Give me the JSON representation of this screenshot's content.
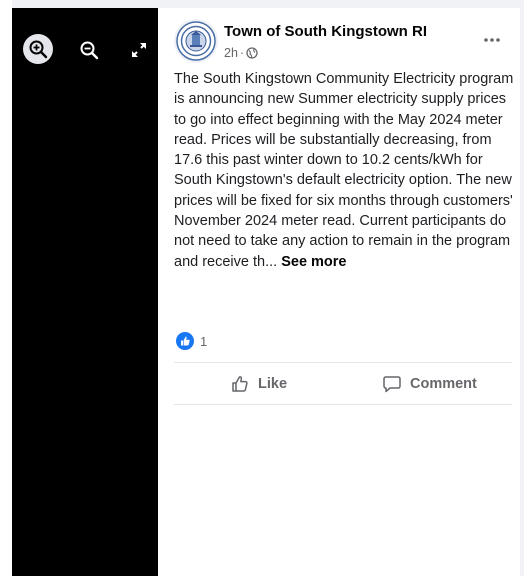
{
  "viewer": {
    "controls": [
      {
        "name": "zoom-in",
        "icon": "zoom-in-icon"
      },
      {
        "name": "zoom-out",
        "icon": "zoom-out-icon"
      },
      {
        "name": "expand",
        "icon": "expand-icon"
      }
    ]
  },
  "post": {
    "page_name": "Town of South Kingstown RI",
    "time": "2h",
    "separator": "·",
    "audience_icon": "globe-icon",
    "avatar_icon": "town-seal-icon",
    "more_icon": "more-dots-icon",
    "body": "The South Kingstown Community Electricity program is announcing new Summer electricity supply prices to go into effect beginning with the May 2024 meter read. Prices will be substantially decreasing, from 17.6 this past winter down to 10.2 cents/kWh for South Kingstown's default electricity option. The new prices will be fixed for six months through customers' November 2024 meter read. Current participants do not need to take any action to remain in the program and receive th...",
    "see_more": "See more"
  },
  "reactions": {
    "icon": "like-reaction-icon",
    "count": "1"
  },
  "actions": {
    "like_label": "Like",
    "comment_label": "Comment",
    "like_icon": "thumbs-up-icon",
    "comment_icon": "comment-bubble-icon"
  },
  "colors": {
    "accent": "#1877f2",
    "text_primary": "#050505",
    "text_secondary": "#65676b",
    "viewer_bg": "#000000"
  }
}
